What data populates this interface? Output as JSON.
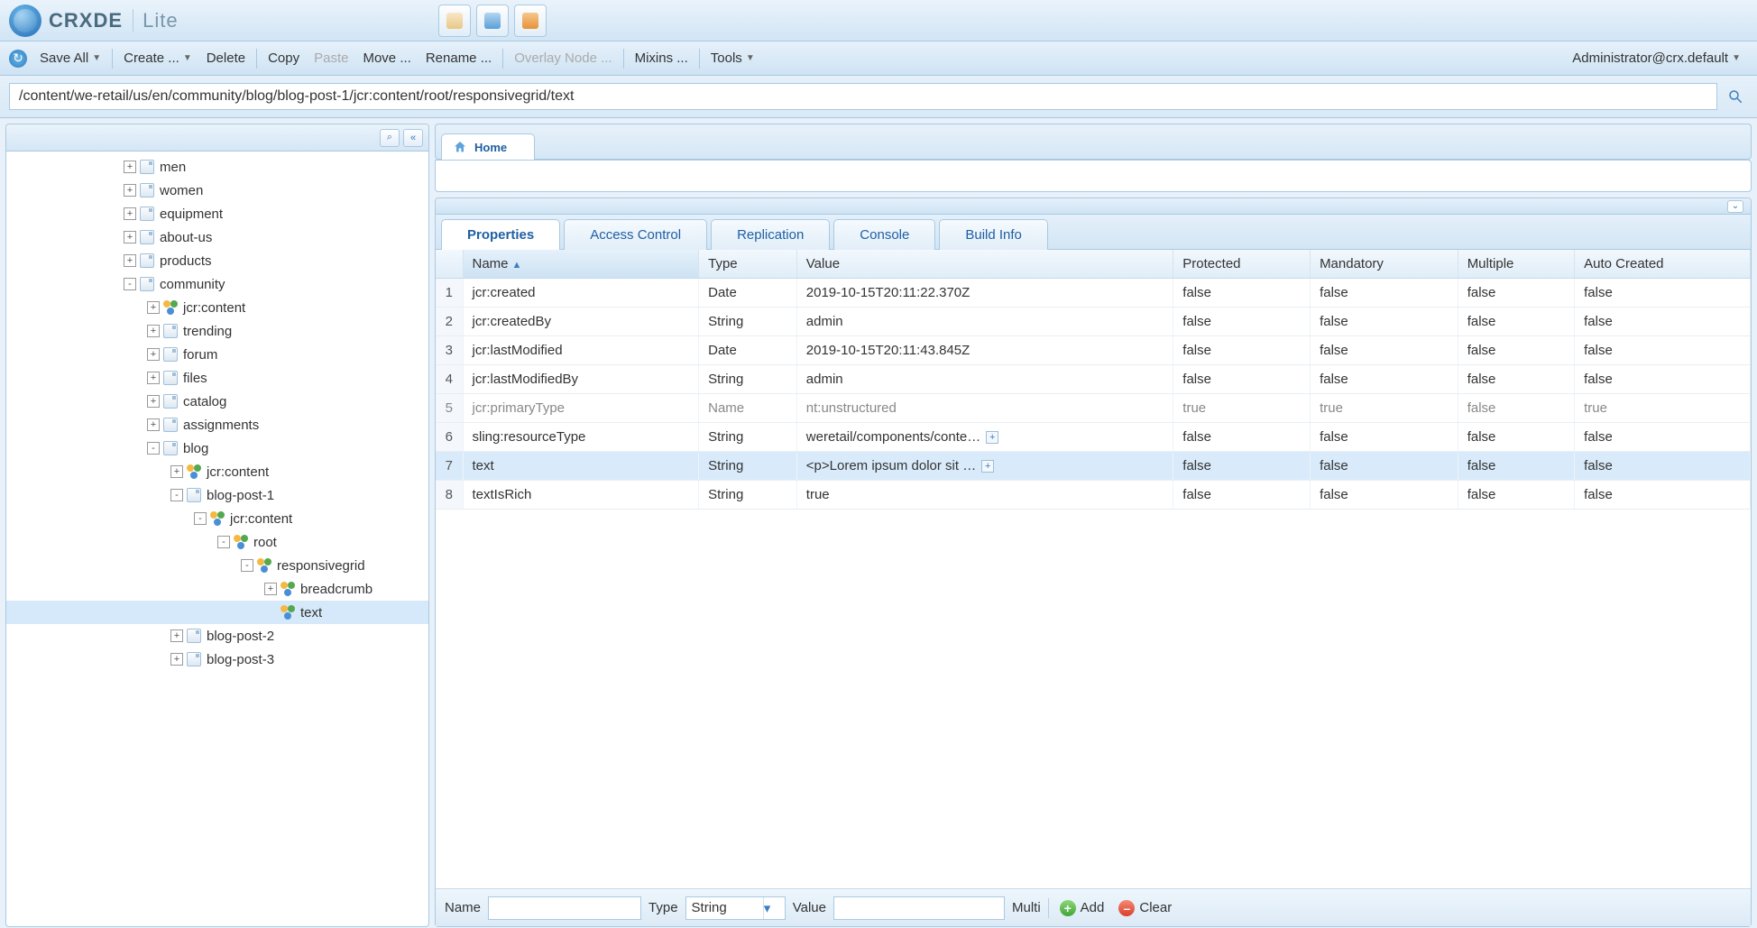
{
  "brand": {
    "name": "CRXDE",
    "suffix": "Lite"
  },
  "toolbar": {
    "saveAll": "Save All",
    "create": "Create ...",
    "delete": "Delete",
    "copy": "Copy",
    "paste": "Paste",
    "move": "Move ...",
    "rename": "Rename ...",
    "overlay": "Overlay Node ...",
    "mixins": "Mixins ...",
    "tools": "Tools",
    "user": "Administrator@crx.default"
  },
  "path": "/content/we-retail/us/en/community/blog/blog-post-1/jcr:content/root/responsivegrid/text",
  "homeTab": "Home",
  "tree": [
    {
      "indent": 5,
      "toggle": "+",
      "icon": "page",
      "label": "men"
    },
    {
      "indent": 5,
      "toggle": "+",
      "icon": "page",
      "label": "women"
    },
    {
      "indent": 5,
      "toggle": "+",
      "icon": "page",
      "label": "equipment"
    },
    {
      "indent": 5,
      "toggle": "+",
      "icon": "page",
      "label": "about-us"
    },
    {
      "indent": 5,
      "toggle": "+",
      "icon": "page",
      "label": "products"
    },
    {
      "indent": 5,
      "toggle": "-",
      "icon": "page",
      "label": "community"
    },
    {
      "indent": 6,
      "toggle": "+",
      "icon": "content",
      "label": "jcr:content"
    },
    {
      "indent": 6,
      "toggle": "+",
      "icon": "page",
      "label": "trending"
    },
    {
      "indent": 6,
      "toggle": "+",
      "icon": "page",
      "label": "forum"
    },
    {
      "indent": 6,
      "toggle": "+",
      "icon": "page",
      "label": "files"
    },
    {
      "indent": 6,
      "toggle": "+",
      "icon": "page",
      "label": "catalog"
    },
    {
      "indent": 6,
      "toggle": "+",
      "icon": "page",
      "label": "assignments"
    },
    {
      "indent": 6,
      "toggle": "-",
      "icon": "page",
      "label": "blog"
    },
    {
      "indent": 7,
      "toggle": "+",
      "icon": "content",
      "label": "jcr:content"
    },
    {
      "indent": 7,
      "toggle": "-",
      "icon": "page",
      "label": "blog-post-1"
    },
    {
      "indent": 8,
      "toggle": "-",
      "icon": "content",
      "label": "jcr:content"
    },
    {
      "indent": 9,
      "toggle": "-",
      "icon": "content",
      "label": "root"
    },
    {
      "indent": 10,
      "toggle": "-",
      "icon": "content",
      "label": "responsivegrid"
    },
    {
      "indent": 11,
      "toggle": "+",
      "icon": "content",
      "label": "breadcrumb"
    },
    {
      "indent": 11,
      "toggle": " ",
      "icon": "content",
      "label": "text",
      "selected": true
    },
    {
      "indent": 7,
      "toggle": "+",
      "icon": "page",
      "label": "blog-post-2"
    },
    {
      "indent": 7,
      "toggle": "+",
      "icon": "page",
      "label": "blog-post-3"
    }
  ],
  "tabs": [
    "Properties",
    "Access Control",
    "Replication",
    "Console",
    "Build Info"
  ],
  "activeTab": 0,
  "columns": [
    "Name",
    "Type",
    "Value",
    "Protected",
    "Mandatory",
    "Multiple",
    "Auto Created"
  ],
  "sortedCol": 0,
  "rows": [
    {
      "n": "1",
      "name": "jcr:created",
      "type": "Date",
      "value": "2019-10-15T20:11:22.370Z",
      "protected": "false",
      "mandatory": "false",
      "multiple": "false",
      "auto": "false"
    },
    {
      "n": "2",
      "name": "jcr:createdBy",
      "type": "String",
      "value": "admin",
      "protected": "false",
      "mandatory": "false",
      "multiple": "false",
      "auto": "false"
    },
    {
      "n": "3",
      "name": "jcr:lastModified",
      "type": "Date",
      "value": "2019-10-15T20:11:43.845Z",
      "protected": "false",
      "mandatory": "false",
      "multiple": "false",
      "auto": "false"
    },
    {
      "n": "4",
      "name": "jcr:lastModifiedBy",
      "type": "String",
      "value": "admin",
      "protected": "false",
      "mandatory": "false",
      "multiple": "false",
      "auto": "false"
    },
    {
      "n": "5",
      "name": "jcr:primaryType",
      "type": "Name",
      "value": "nt:unstructured",
      "protected": "true",
      "mandatory": "true",
      "multiple": "false",
      "auto": "true",
      "protectedRow": true
    },
    {
      "n": "6",
      "name": "sling:resourceType",
      "type": "String",
      "value": "weretail/components/conte…",
      "protected": "false",
      "mandatory": "false",
      "multiple": "false",
      "auto": "false",
      "expand": true
    },
    {
      "n": "7",
      "name": "text",
      "type": "String",
      "value": "<p>Lorem ipsum dolor sit …",
      "protected": "false",
      "mandatory": "false",
      "multiple": "false",
      "auto": "false",
      "expand": true,
      "selected": true
    },
    {
      "n": "8",
      "name": "textIsRich",
      "type": "String",
      "value": "true",
      "protected": "false",
      "mandatory": "false",
      "multiple": "false",
      "auto": "false"
    }
  ],
  "bottom": {
    "nameLabel": "Name",
    "typeLabel": "Type",
    "typeValue": "String",
    "valueLabel": "Value",
    "multiLabel": "Multi",
    "addLabel": "Add",
    "clearLabel": "Clear"
  }
}
